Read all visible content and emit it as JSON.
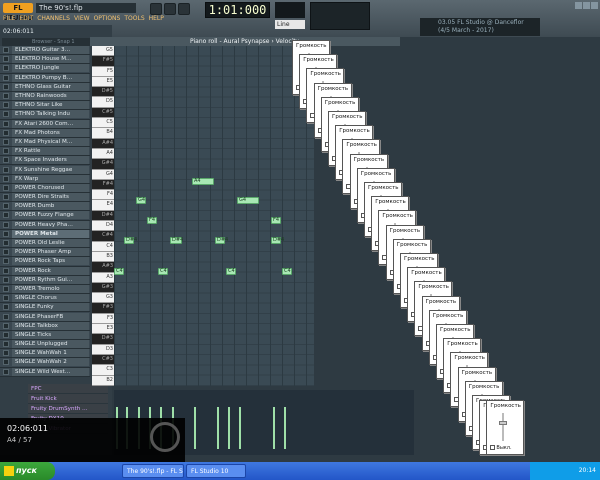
{
  "header": {
    "logo": "FL STUDIO",
    "file_title": "The 90's!.flp",
    "menu": [
      "FILE",
      "EDIT",
      "CHANNELS",
      "VIEW",
      "OPTIONS",
      "TOOLS",
      "HELP"
    ],
    "time_display": "1:01:000",
    "pattern_label": "Line",
    "news": "03.05 FL Studio @ Danceflor (4/5 March - 2017)"
  },
  "left": {
    "song_time": "02:06:011",
    "position": "A4 / 57",
    "browser_tab": "Browser - Snap 1",
    "channels": [
      "ELEKTRO Guitar 3…",
      "ELEKTRO House M…",
      "ELEKTRO Jungle",
      "ELEKTRO Pumpy B…",
      "ETHNO Glass Guitar",
      "ETHNO Rainwoods",
      "ETHNO Sitar Like",
      "ETHNO Talking Indu",
      "FX Atari 2600 Com…",
      "FX Mad Photons",
      "FX Mad Physical M…",
      "FX Rattle",
      "FX Space Invaders",
      "FX Sunshine Reggae",
      "FX Warp",
      "POWER Chorused",
      "POWER Dire Straits",
      "POWER Dumb",
      "POWER Fuzzy Flange",
      "POWER Heavy Pha…",
      "POWER Metal",
      "POWER Old Leslie",
      "POWER Phaser Amp",
      "POWER Rock Taps",
      "POWER Rock",
      "POWER Rythm Gui…",
      "POWER Tremolo",
      "SINGLE Chorus",
      "SINGLE Funky",
      "SINGLE PhaserFB",
      "SINGLE Talkbox",
      "SINGLE Ticks",
      "SINGLE Unplugged",
      "SINGLE WahWah 1",
      "SINGLE WahWah 2",
      "SINGLE Wild West…"
    ],
    "selected_channel_index": 20,
    "fx": [
      "FPC",
      "Fruit Kick",
      "Fruity DrumSynth …",
      "Fruity DX10",
      "Fruity Vibrator"
    ]
  },
  "pianoroll": {
    "title": "Piano roll - Aural Psynapse",
    "target": "Velocity",
    "keys": [
      {
        "l": "G5",
        "b": false
      },
      {
        "l": "F#5",
        "b": true
      },
      {
        "l": "F5",
        "b": false
      },
      {
        "l": "E5",
        "b": false
      },
      {
        "l": "D#5",
        "b": true
      },
      {
        "l": "D5",
        "b": false
      },
      {
        "l": "C#5",
        "b": true
      },
      {
        "l": "C5",
        "b": false
      },
      {
        "l": "B4",
        "b": false
      },
      {
        "l": "A#4",
        "b": true
      },
      {
        "l": "A4",
        "b": false
      },
      {
        "l": "G#4",
        "b": true
      },
      {
        "l": "G4",
        "b": false
      },
      {
        "l": "F#4",
        "b": true
      },
      {
        "l": "F4",
        "b": false
      },
      {
        "l": "E4",
        "b": false
      },
      {
        "l": "D#4",
        "b": true
      },
      {
        "l": "D4",
        "b": false
      },
      {
        "l": "C#4",
        "b": true
      },
      {
        "l": "C4",
        "b": false
      },
      {
        "l": "B3",
        "b": false
      },
      {
        "l": "A#3",
        "b": true
      },
      {
        "l": "A3",
        "b": false
      },
      {
        "l": "G#3",
        "b": true
      },
      {
        "l": "G3",
        "b": false
      },
      {
        "l": "F#3",
        "b": true
      },
      {
        "l": "F3",
        "b": false
      },
      {
        "l": "E3",
        "b": false
      },
      {
        "l": "D#3",
        "b": true
      },
      {
        "l": "D3",
        "b": false
      },
      {
        "l": "C#3",
        "b": true
      },
      {
        "l": "C3",
        "b": false
      },
      {
        "l": "B2",
        "b": false
      }
    ],
    "notes": [
      {
        "label": "A4"
      },
      {
        "label": "G4"
      },
      {
        "label": "G4"
      },
      {
        "label": "F4"
      },
      {
        "label": "F4"
      },
      {
        "label": "D#4"
      },
      {
        "label": "D#4"
      },
      {
        "label": "D#4"
      },
      {
        "label": "D#4"
      },
      {
        "label": "C4"
      },
      {
        "label": "C4"
      },
      {
        "label": "C4"
      },
      {
        "label": "C4"
      }
    ]
  },
  "dialog": {
    "title": "Громкость",
    "mute": "Выкл."
  },
  "taskbar": {
    "start": "пуск",
    "items": [
      "The 90's!.flp - FL Studio",
      "FL Studio 10"
    ],
    "clock": "20:14"
  }
}
